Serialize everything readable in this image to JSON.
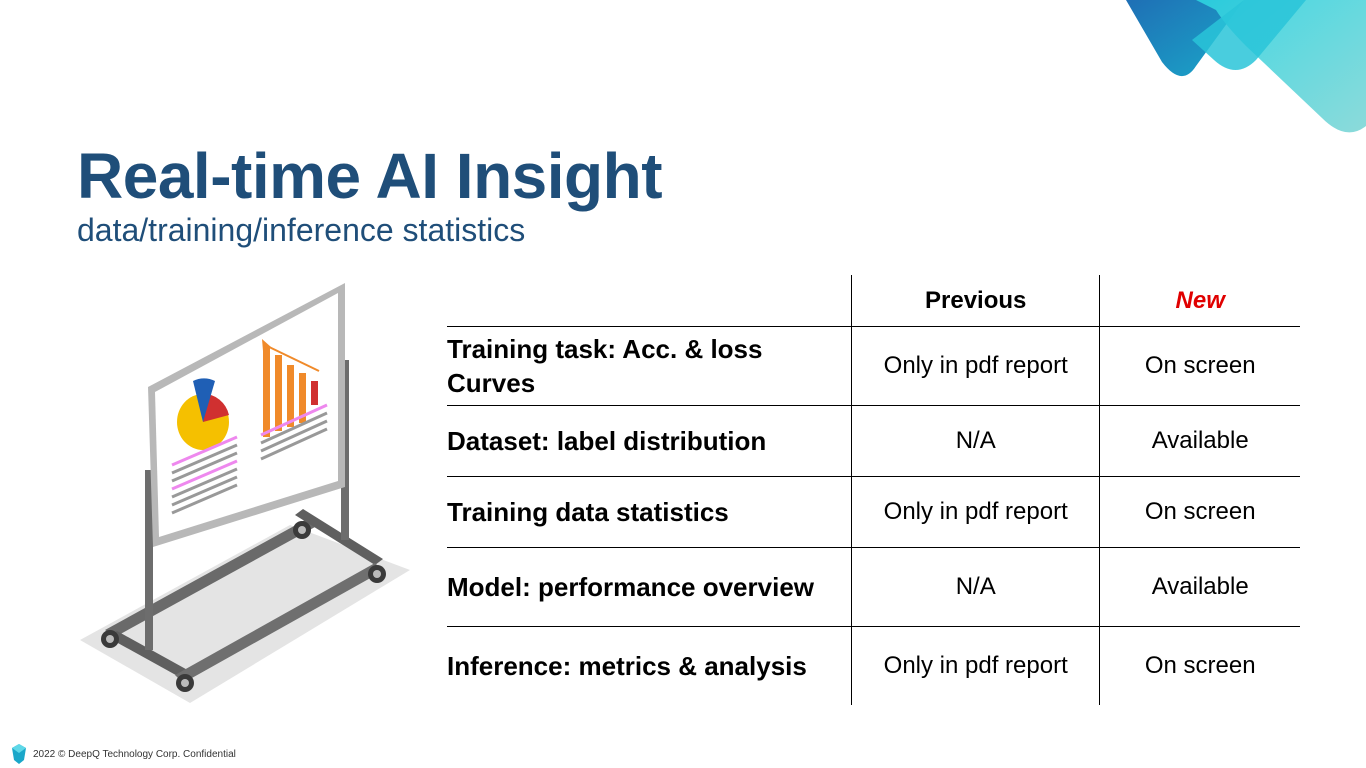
{
  "slide": {
    "title": "Real-time AI Insight",
    "subtitle": "data/training/inference statistics"
  },
  "table": {
    "headers": {
      "feature": "",
      "previous": "Previous",
      "new": "New"
    },
    "rows": [
      {
        "feature": "Training task: Acc. & loss Curves",
        "previous": "Only in pdf report",
        "new": "On screen"
      },
      {
        "feature": "Dataset: label distribution",
        "previous": "N/A",
        "new": "Available"
      },
      {
        "feature": "Training data statistics",
        "previous": "Only in pdf report",
        "new": "On screen"
      },
      {
        "feature": "Model: performance overview",
        "previous": "N/A",
        "new": "Available"
      },
      {
        "feature": "Inference: metrics & analysis",
        "previous": "Only in pdf report",
        "new": "On screen"
      }
    ]
  },
  "footer": {
    "text": "2022 © DeepQ Technology Corp. Confidential"
  },
  "colors": {
    "title": "#1f4e79",
    "new_header": "#e00000",
    "accent_teal": "#2bc6d6",
    "accent_blue": "#1f6fb5"
  },
  "icons": {
    "illustration": "whiteboard-chart-illustration",
    "corner": "teal-corner-decoration",
    "footer_logo": "deepq-logo-icon"
  }
}
